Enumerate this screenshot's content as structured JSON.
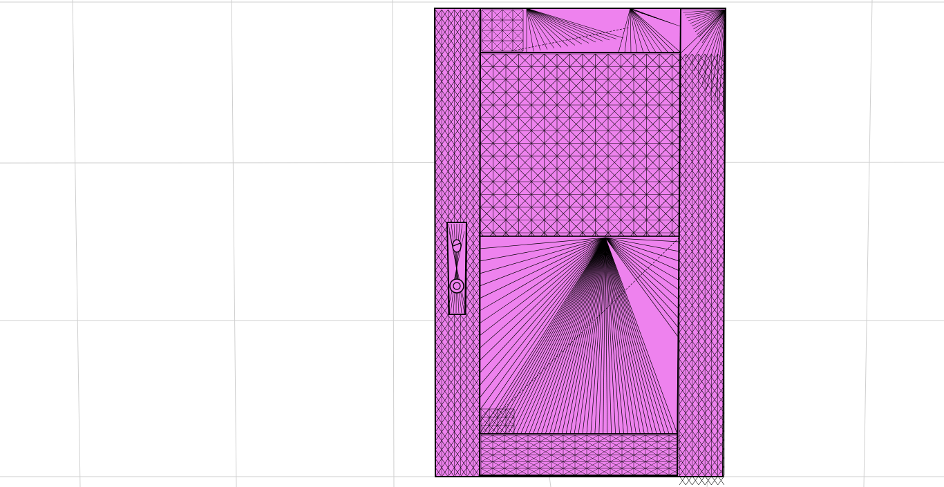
{
  "viewport": {
    "background_color": "#ffffff",
    "grid_color": "#cfcfcf",
    "mesh_fill_color": "#ee82ee",
    "mesh_line_color": "#000000"
  },
  "model": {
    "panels": [
      "left-stile",
      "top-rail",
      "upper-panel",
      "lower-panel",
      "bottom-rail",
      "right-stile"
    ],
    "hardware": [
      "door-handle",
      "keyhole"
    ]
  }
}
